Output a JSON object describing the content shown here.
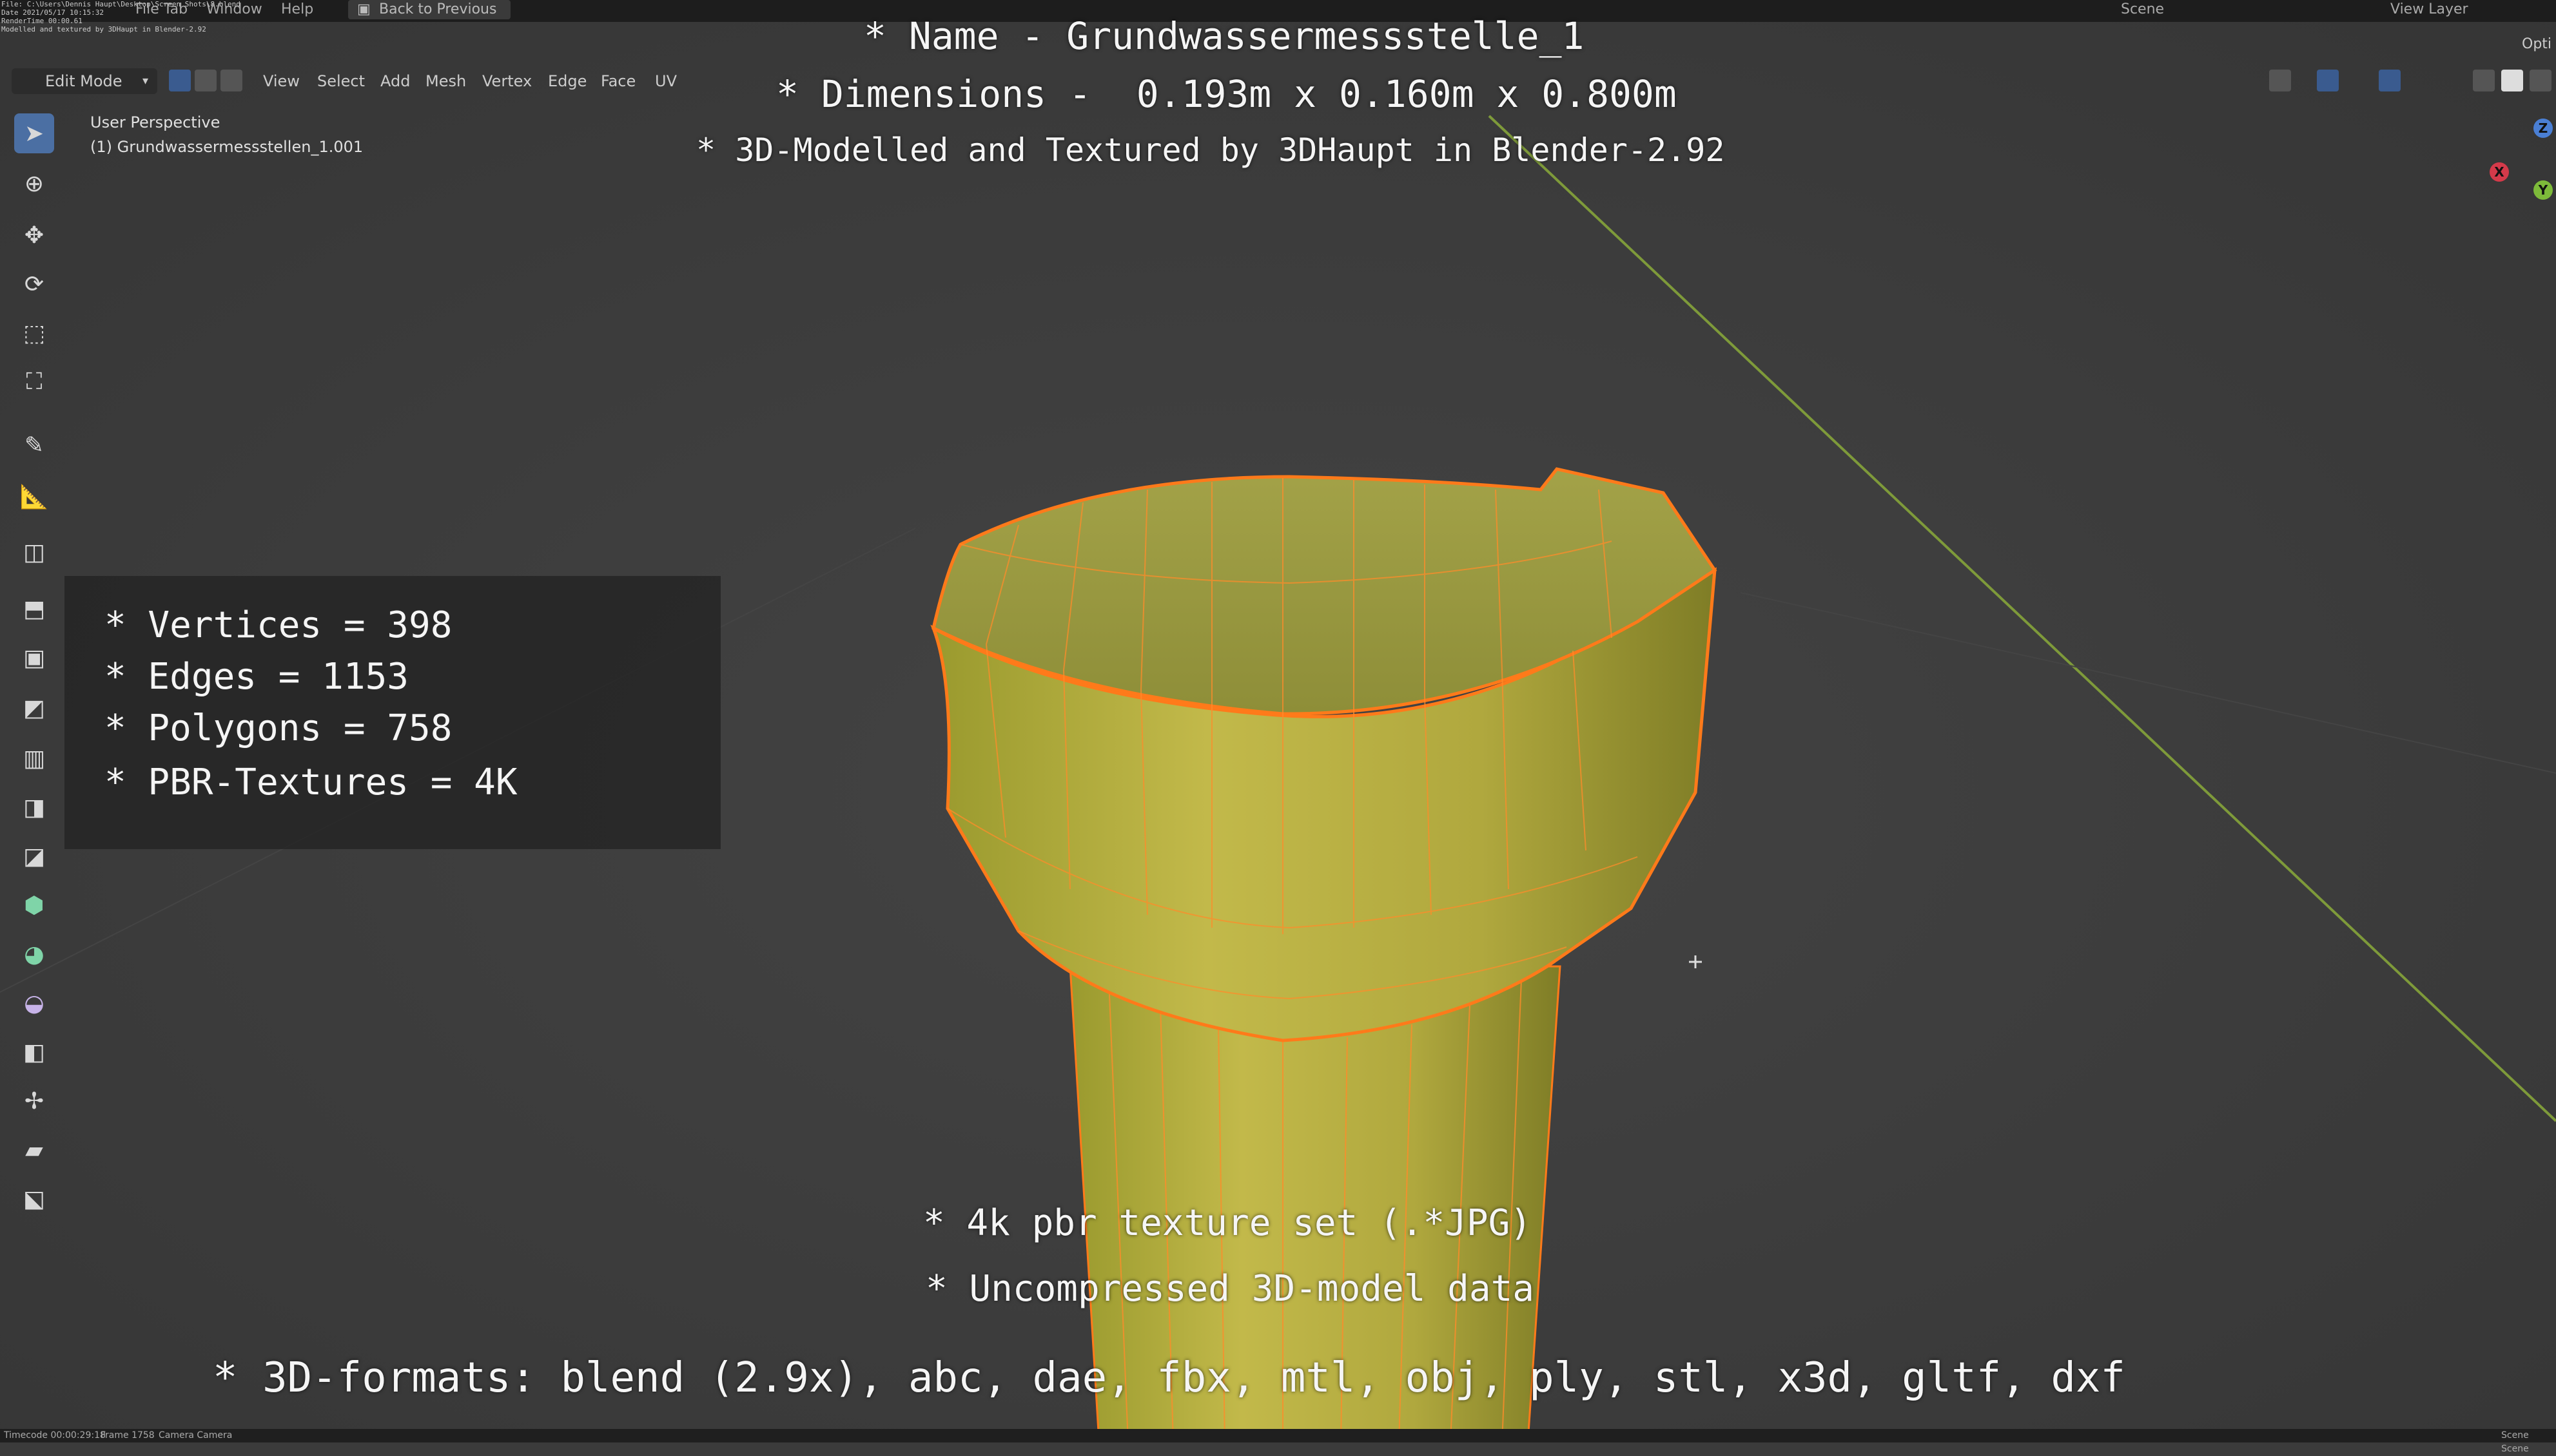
{
  "topbar": {
    "sysinfo_lines": [
      "File: C:\\Users\\Dennis Haupt\\Desktop\\Screen Shots\\8.blend",
      "Date 2021/05/17 10:15:32",
      "RenderTime 00:00.61",
      "Modelled and textured by 3DHaupt in Blender-2.92"
    ],
    "menu_file_tail": "File Tab",
    "menu_window": "Window",
    "menu_help": "Help",
    "back_button": "Back to Previous",
    "scene_label": "Scene",
    "view_layer_label": "View Layer"
  },
  "header": {
    "mode": "Edit Mode",
    "menus": [
      "View",
      "Select",
      "Add",
      "Mesh",
      "Vertex",
      "Edge",
      "Face",
      "UV"
    ],
    "options": "Opti"
  },
  "viewport": {
    "perspective": "User Perspective",
    "object": "(1) Grundwassermessstellen_1.001"
  },
  "overlay": {
    "name_line": "* Name - Grundwassermessstelle_1",
    "dimensions_line": "* Dimensions -  0.193m x 0.160m x 0.800m",
    "credit_line": "* 3D-Modelled and Textured by 3DHaupt in Blender-2.92",
    "texture_line": "* 4k pbr texture set (.*JPG)",
    "uncompressed_line": "* Uncompressed 3D-model data",
    "formats_line": "* 3D-formats: blend (2.9x), abc, dae, fbx, mtl, obj, ply, stl, x3d, gltf, dxf"
  },
  "stats": {
    "vertices": "* Vertices = 398",
    "edges": "* Edges = 1153",
    "polygons": "* Polygons = 758",
    "textures": "* PBR-Textures = 4K"
  },
  "gizmo": {
    "x": "X",
    "y": "Y",
    "z": "Z"
  },
  "statusbar": {
    "timecode": "Timecode 00:00:29:18",
    "frame": "Frame 1758",
    "camera": "Camera Camera",
    "scene": "Scene Scene"
  },
  "colors": {
    "mesh_fill": "#a6a33e",
    "mesh_edge": "#ff7a1a",
    "axis_line": "#7e9a3a",
    "active_tool": "#4b6fa3"
  },
  "icons": [
    "cursor-select-icon",
    "3d-cursor-icon",
    "move-icon",
    "rotate-icon",
    "scale-icon",
    "transform-icon",
    "annotate-icon",
    "measure-icon",
    "add-cube-icon",
    "extrude-icon",
    "inset-icon",
    "bevel-icon",
    "loop-cut-icon",
    "knife-icon",
    "poly-build-icon",
    "spin-icon",
    "smooth-icon",
    "edge-slide-icon",
    "shrink-fatten-icon",
    "shear-icon",
    "rip-icon"
  ]
}
